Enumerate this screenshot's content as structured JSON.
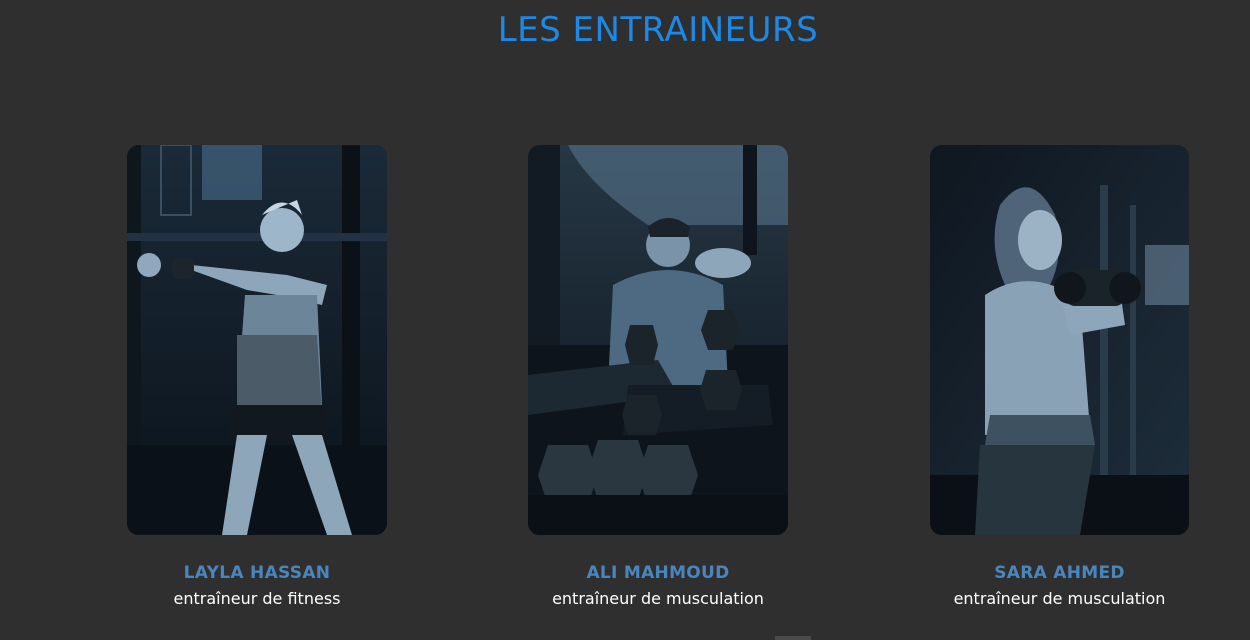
{
  "section": {
    "title": "LES ENTRAINEURS"
  },
  "trainers": [
    {
      "name": "LAYLA HASSAN",
      "role": "entraîneur de fitness",
      "photo": "woman-kettlebell-photo"
    },
    {
      "name": "ALI MAHMOUD",
      "role": "entraîneur de musculation",
      "photo": "man-dumbbells-photo"
    },
    {
      "name": "SARA AHMED",
      "role": "entraîneur de musculation",
      "photo": "woman-curl-photo"
    }
  ],
  "colors": {
    "background": "#2f2f2f",
    "title": "#1e88e5",
    "name": "#4a86bd",
    "role": "#ffffff"
  }
}
